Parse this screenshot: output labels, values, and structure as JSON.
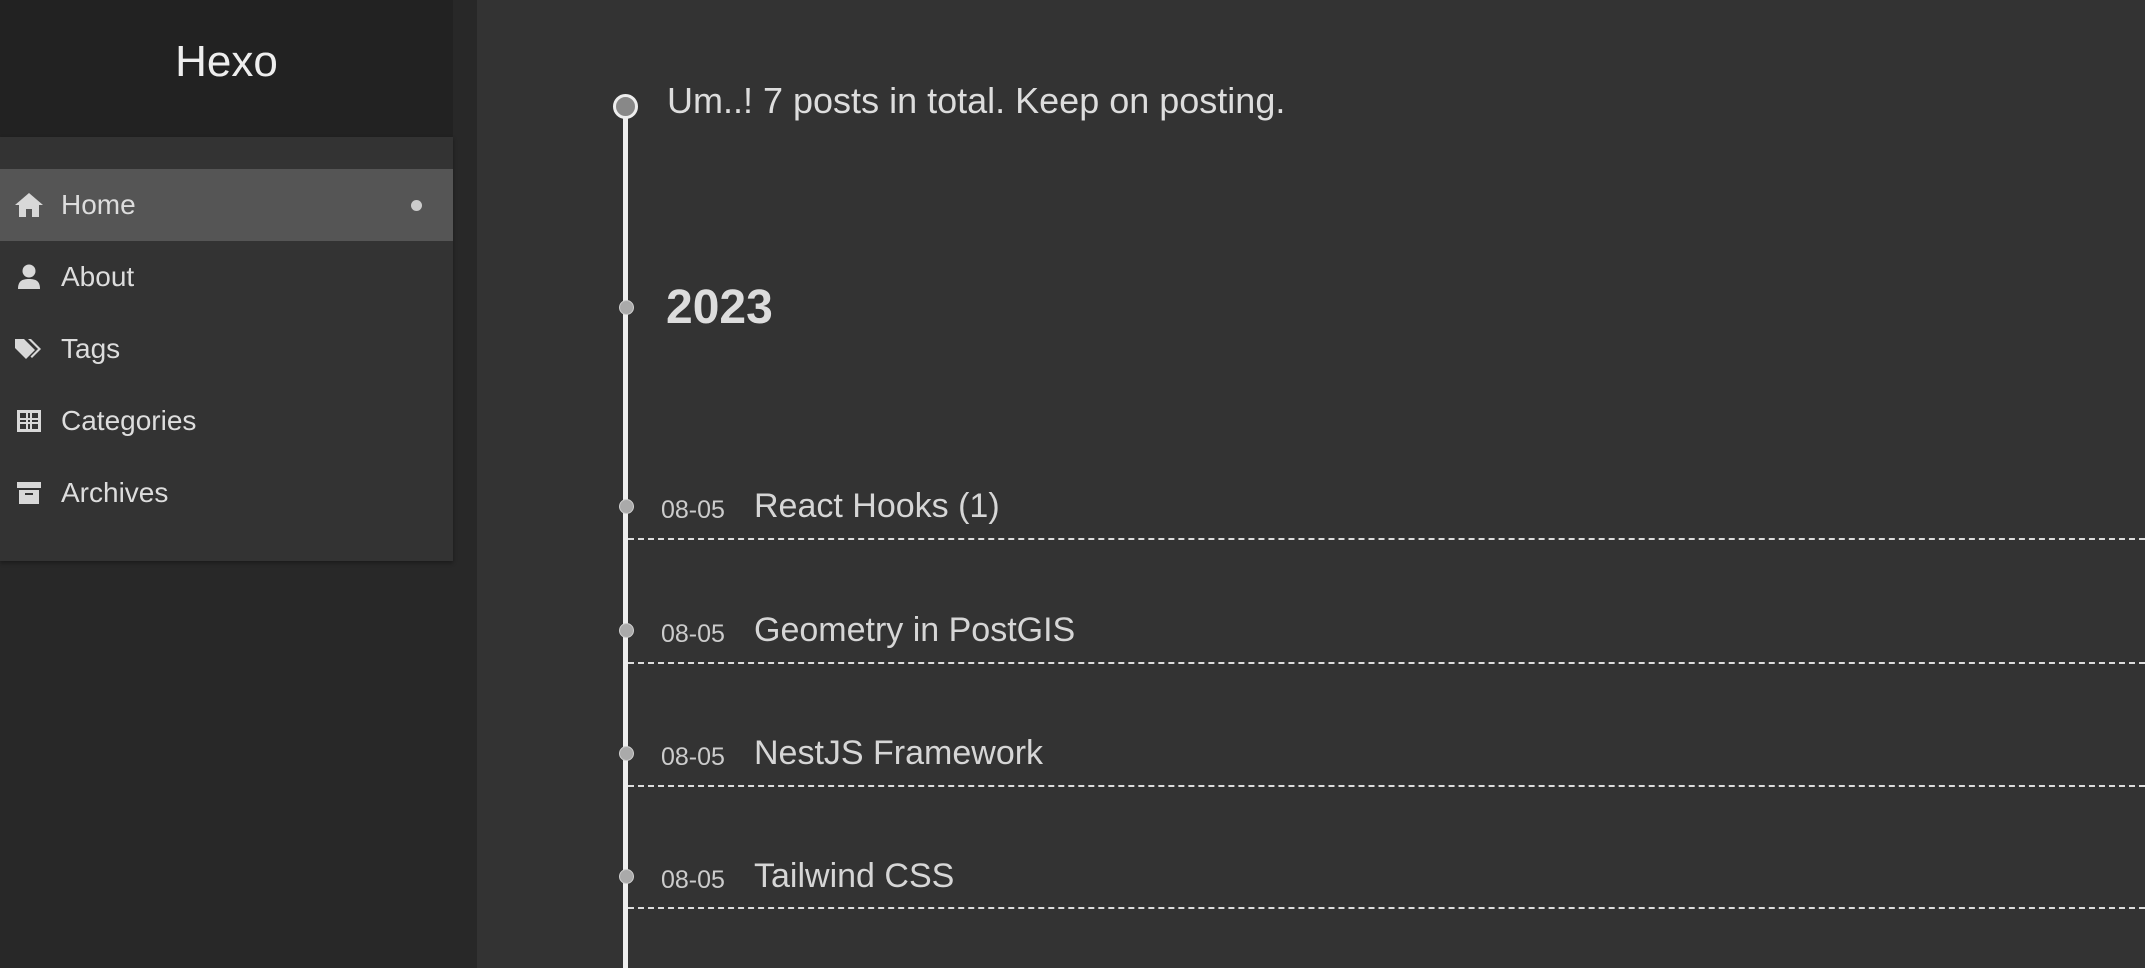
{
  "sidebar": {
    "brand": "Hexo",
    "menu": [
      {
        "label": "Home",
        "icon": "home-icon",
        "active": true
      },
      {
        "label": "About",
        "icon": "user-icon",
        "active": false
      },
      {
        "label": "Tags",
        "icon": "tags-icon",
        "active": false
      },
      {
        "label": "Categories",
        "icon": "grid-icon",
        "active": false
      },
      {
        "label": "Archives",
        "icon": "archive-icon",
        "active": false
      }
    ]
  },
  "archive": {
    "summary": "Um..! 7 posts in total. Keep on posting.",
    "year": "2023",
    "posts": [
      {
        "date": "08-05",
        "title": "React Hooks (1)"
      },
      {
        "date": "08-05",
        "title": "Geometry in PostGIS"
      },
      {
        "date": "08-05",
        "title": "NestJS Framework"
      },
      {
        "date": "08-05",
        "title": "Tailwind CSS"
      }
    ]
  },
  "colors": {
    "background": "#333333",
    "sidebar": "#282828",
    "brand_bar": "#222222",
    "active_item": "#555555",
    "text": "#dddddd"
  }
}
